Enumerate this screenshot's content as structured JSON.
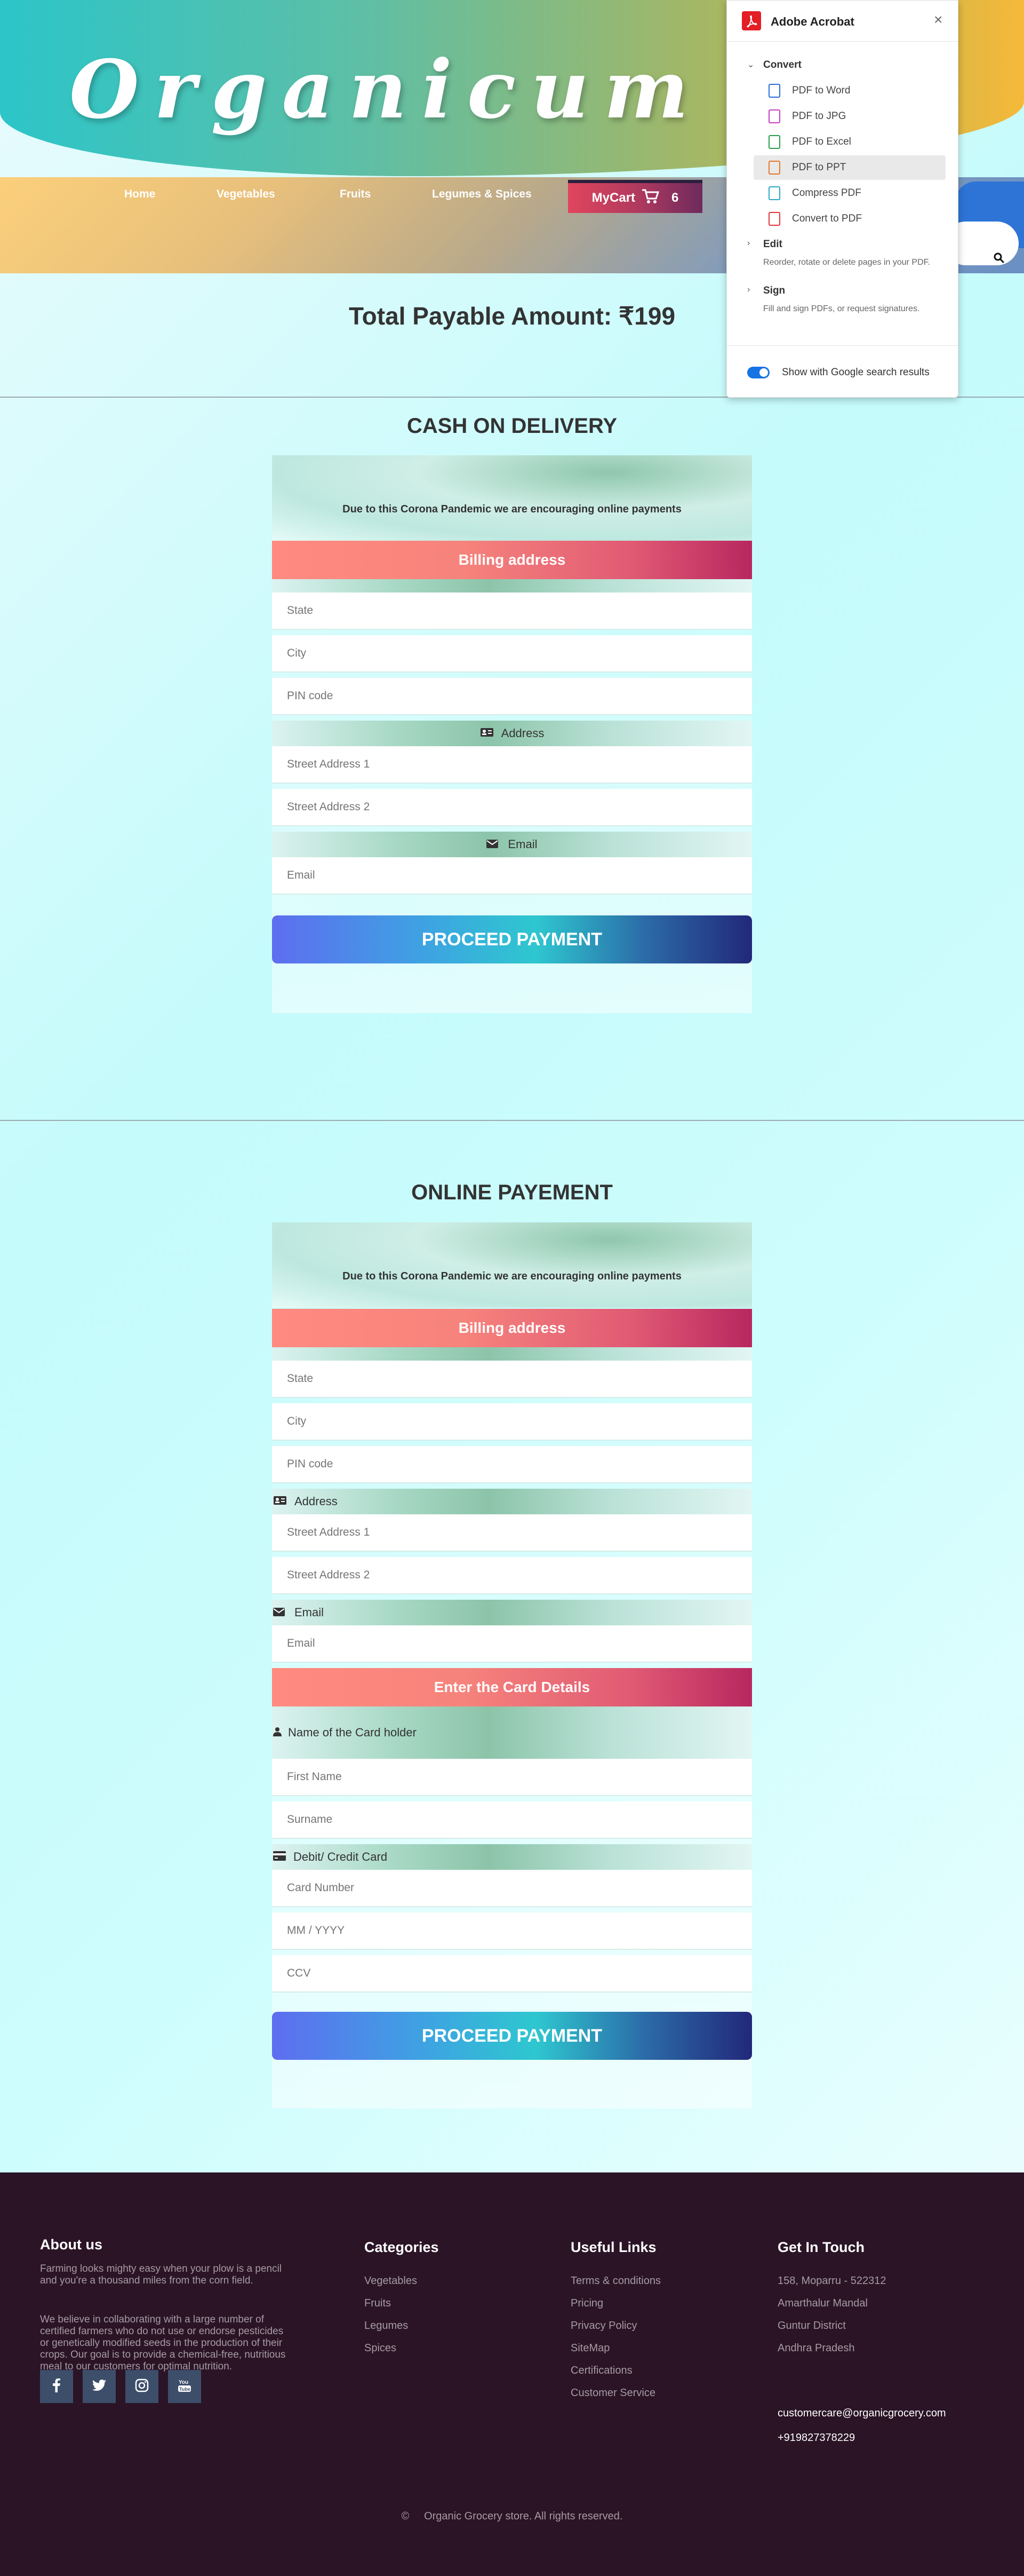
{
  "header": {
    "brand": "Organicum Sal",
    "nav": [
      "Home",
      "Vegetables",
      "Fruits",
      "Legumes & Spices"
    ],
    "cart_label": "MyCart",
    "cart_count": "6"
  },
  "total_label": "Total Payable Amount: ₹199",
  "cod": {
    "title": "CASH ON DELIVERY",
    "notice": "Due to this Corona Pandemic we are encouraging online payments",
    "billing": "Billing address",
    "state_ph": "State",
    "city_ph": "City",
    "pin_ph": "PIN code",
    "address_label": "Address",
    "street1_ph": "Street Address 1",
    "street2_ph": "Street Address 2",
    "email_label": "Email",
    "email_ph": "Email",
    "proceed": "PROCEED PAYMENT"
  },
  "online": {
    "title": "ONLINE PAYEMENT",
    "notice": "Due to this Corona Pandemic we are encouraging online payments",
    "billing": "Billing address",
    "state_ph": "State",
    "city_ph": "City",
    "pin_ph": "PIN code",
    "address_label": "Address",
    "street1_ph": "Street Address 1",
    "street2_ph": "Street Address 2",
    "email_label": "Email",
    "email_ph": "Email",
    "card_details": "Enter the Card Details",
    "holder_label": "Name of the Card holder",
    "first_ph": "First Name",
    "surname_ph": "Surname",
    "card_label": "Debit/ Credit Card",
    "cardno_ph": "Card Number",
    "expiry_ph": "MM / YYYY",
    "ccv_ph": "CCV",
    "proceed": "PROCEED PAYMENT"
  },
  "footer": {
    "about_title": "About us",
    "about_p1": "Farming looks mighty easy when your plow is a pencil and you're a thousand miles from the corn field.",
    "about_p2": "We believe in collaborating with a large number of certified farmers who do not use or endorse pesticides or genetically modified seeds in the production of their crops. Our goal is to provide a chemical-free, nutritious meal to our customers for optimal nutrition.",
    "categories_title": "Categories",
    "categories": [
      "Vegetables",
      "Fruits",
      "Legumes",
      "Spices"
    ],
    "links_title": "Useful Links",
    "links": [
      "Terms & conditions",
      "Pricing",
      "Privacy Policy",
      "SiteMap",
      "Certifications",
      "Customer Service"
    ],
    "touch_title": "Get In Touch",
    "address": [
      "158, Moparru - 522312",
      "Amarthalur Mandal",
      "Guntur District",
      "Andhra Pradesh"
    ],
    "email": "customercare@organicgrocery.com",
    "phone": "+919827378229",
    "copyright_symbol": "©",
    "copyright": "Organic Grocery store. All rights reserved."
  },
  "acrobat": {
    "title": "Adobe Acrobat",
    "convert": "Convert",
    "items": [
      "PDF to Word",
      "PDF to JPG",
      "PDF to Excel",
      "PDF to PPT",
      "Compress PDF",
      "Convert to PDF"
    ],
    "edit": "Edit",
    "edit_desc": "Reorder, rotate or delete pages in your PDF.",
    "sign": "Sign",
    "sign_desc": "Fill and sign PDFs, or request signatures.",
    "toggle_label": "Show with Google search results"
  }
}
